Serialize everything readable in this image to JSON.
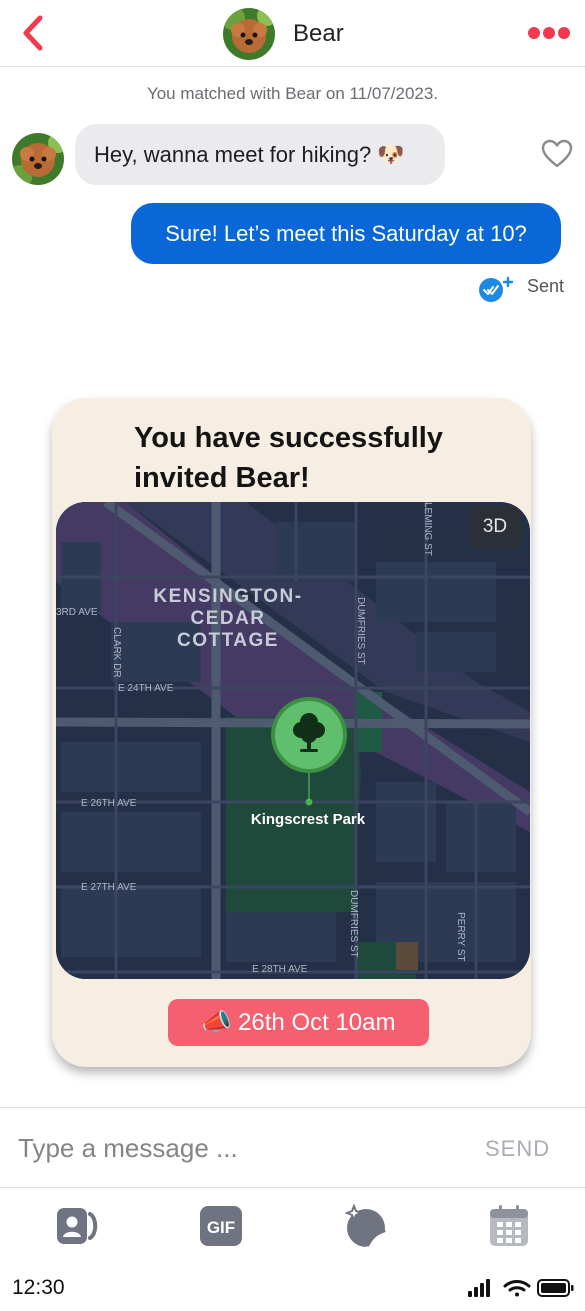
{
  "header": {
    "contact_name": "Bear"
  },
  "conversation": {
    "match_note": "You matched with Bear on 11/07/2023.",
    "messages": [
      {
        "direction": "in",
        "text": "Hey, wanna meet for hiking? 🐶"
      },
      {
        "direction": "out",
        "text": "Sure! Let’s meet this Saturday at 10?"
      }
    ],
    "status": "Sent"
  },
  "invite_card": {
    "title": "You have successfully invited Bear!",
    "map": {
      "toggle_3d": "3D",
      "place_label": "Kingscrest Park",
      "neighborhood": [
        "KENSINGTON-",
        "CEDAR",
        "COTTAGE"
      ],
      "streets": [
        "3RD AVE",
        "CLARK DR",
        "E 24TH AVE",
        "E 26TH AVE",
        "E 27TH AVE",
        "E 28TH AVE",
        "DUMFRIES ST",
        "DUMFRIES ST",
        "PERRY ST",
        "LEMING ST"
      ]
    },
    "date": "📣 26th Oct 10am"
  },
  "composer": {
    "placeholder": "Type a message ...",
    "send_label": "SEND"
  },
  "toolbar": {
    "gif_label": "GIF"
  },
  "status_bar": {
    "time": "12:30"
  },
  "colors": {
    "accent_red": "#f2394e",
    "outgoing_bubble": "#0a67d8",
    "incoming_bubble": "#ebebee",
    "card_background": "#f6eee2",
    "date_pill": "#f4606f",
    "map_background": "#243047",
    "toolbar_icon": "#6f7480"
  },
  "icons": [
    "chevron-left-icon",
    "more-dots-icon",
    "heart-icon",
    "double-check-icon",
    "tree-icon",
    "contact-card-icon",
    "gif-icon",
    "magic-sticker-icon",
    "calendar-icon",
    "signal-icon",
    "wifi-icon",
    "battery-icon"
  ]
}
